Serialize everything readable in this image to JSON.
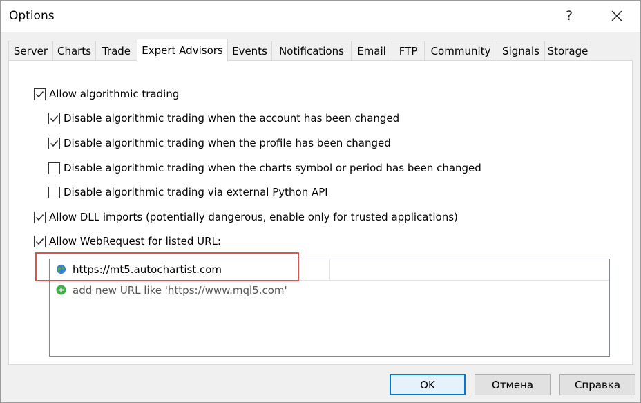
{
  "window": {
    "title": "Options",
    "help_label": "?"
  },
  "tabs": [
    {
      "label": "Server"
    },
    {
      "label": "Charts"
    },
    {
      "label": "Trade"
    },
    {
      "label": "Expert Advisors",
      "active": true
    },
    {
      "label": "Events"
    },
    {
      "label": "Notifications"
    },
    {
      "label": "Email"
    },
    {
      "label": "FTP"
    },
    {
      "label": "Community"
    },
    {
      "label": "Signals"
    },
    {
      "label": "Storage"
    }
  ],
  "options": [
    {
      "label": "Allow algorithmic trading",
      "checked": true
    },
    {
      "label": "Disable algorithmic trading when the account has been changed",
      "checked": true
    },
    {
      "label": "Disable algorithmic trading when the profile has been changed",
      "checked": true
    },
    {
      "label": "Disable algorithmic trading when the charts symbol or period has been changed",
      "checked": false
    },
    {
      "label": "Disable algorithmic trading via external Python API",
      "checked": false
    },
    {
      "label": "Allow DLL imports (potentially dangerous, enable only for trusted applications)",
      "checked": true
    },
    {
      "label": "Allow WebRequest for listed URL:",
      "checked": true
    }
  ],
  "url_list": {
    "urls": [
      "https://mt5.autochartist.com"
    ],
    "add_placeholder": "add new URL like 'https://www.mql5.com'"
  },
  "buttons": {
    "ok": "OK",
    "cancel": "Отмена",
    "help": "Справка"
  },
  "colors": {
    "accent": "#0078d7",
    "highlight": "#d9534f",
    "add_icon": "#3cb043"
  }
}
